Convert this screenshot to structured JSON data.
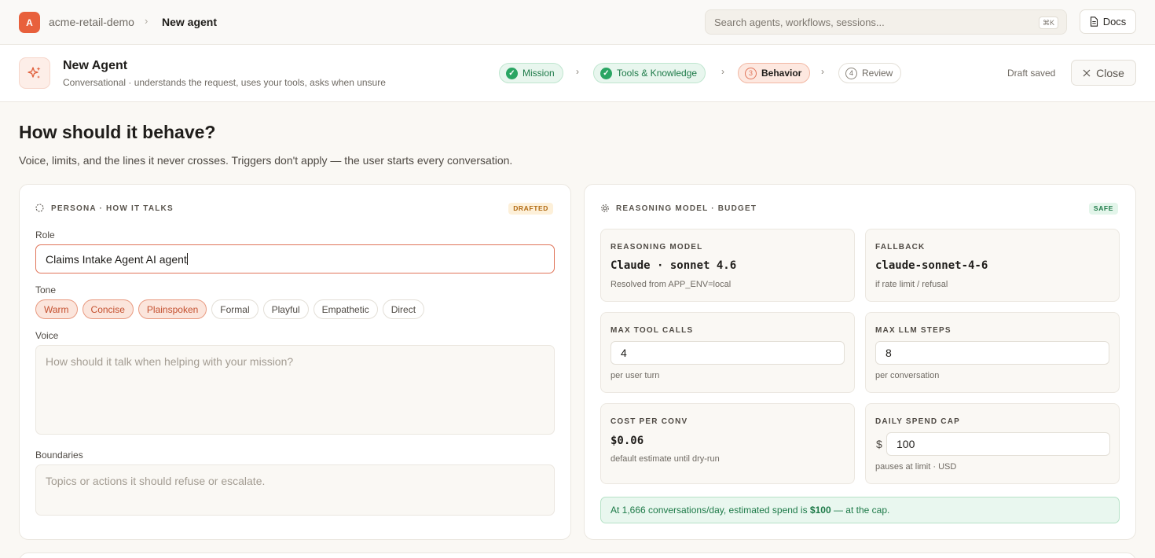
{
  "topbar": {
    "workspace_initial": "A",
    "workspace_name": "acme-retail-demo",
    "crumb_separator": "›",
    "current_page": "New agent",
    "search_placeholder": "Search agents, workflows, sessions...",
    "search_shortcut": "⌘K",
    "docs_label": "Docs"
  },
  "header": {
    "title": "New Agent",
    "subtitle": "Conversational · understands the request, uses your tools, asks when unsure",
    "steps": [
      {
        "label": "Mission",
        "state": "done"
      },
      {
        "label": "Tools & Knowledge",
        "state": "done"
      },
      {
        "number": "3",
        "label": "Behavior",
        "state": "active"
      },
      {
        "number": "4",
        "label": "Review",
        "state": "todo"
      }
    ],
    "draft_status": "Draft saved",
    "close_label": "Close"
  },
  "page": {
    "title": "How should it behave?",
    "subtitle": "Voice, limits, and the lines it never crosses. Triggers don't apply — the user starts every conversation."
  },
  "persona": {
    "section_title": "PERSONA · HOW IT TALKS",
    "badge": "DRAFTED",
    "role_label": "Role",
    "role_value": "Claims Intake Agent AI agent",
    "tone_label": "Tone",
    "tones": [
      {
        "label": "Warm",
        "selected": true
      },
      {
        "label": "Concise",
        "selected": true
      },
      {
        "label": "Plainspoken",
        "selected": true
      },
      {
        "label": "Formal",
        "selected": false
      },
      {
        "label": "Playful",
        "selected": false
      },
      {
        "label": "Empathetic",
        "selected": false
      },
      {
        "label": "Direct",
        "selected": false
      }
    ],
    "voice_label": "Voice",
    "voice_placeholder": "How should it talk when helping with your mission?",
    "boundaries_label": "Boundaries",
    "boundaries_placeholder": "Topics or actions it should refuse or escalate."
  },
  "budget": {
    "section_title": "REASONING MODEL · BUDGET",
    "badge": "SAFE",
    "reasoning_model": {
      "label": "REASONING MODEL",
      "value": "Claude · sonnet 4.6",
      "note": "Resolved from APP_ENV=local"
    },
    "fallback": {
      "label": "FALLBACK",
      "value": "claude-sonnet-4-6",
      "note": "if rate limit / refusal"
    },
    "max_tool_calls": {
      "label": "MAX TOOL CALLS",
      "value": "4",
      "note": "per user turn"
    },
    "max_llm_steps": {
      "label": "MAX LLM STEPS",
      "value": "8",
      "note": "per conversation"
    },
    "cost_per_conv": {
      "label": "COST PER CONV",
      "value": "$0.06",
      "note": "default estimate until dry-run"
    },
    "daily_spend_cap": {
      "label": "DAILY SPEND CAP",
      "currency": "$",
      "value": "100",
      "note": "pauses at limit · USD"
    },
    "estimate": {
      "prefix": "At 1,666 conversations/day, estimated spend is ",
      "amount": "$100",
      "suffix": " — at the cap."
    }
  },
  "colors": {
    "accent": "#e8603c",
    "success": "#2aa563",
    "background": "#faf8f4"
  }
}
